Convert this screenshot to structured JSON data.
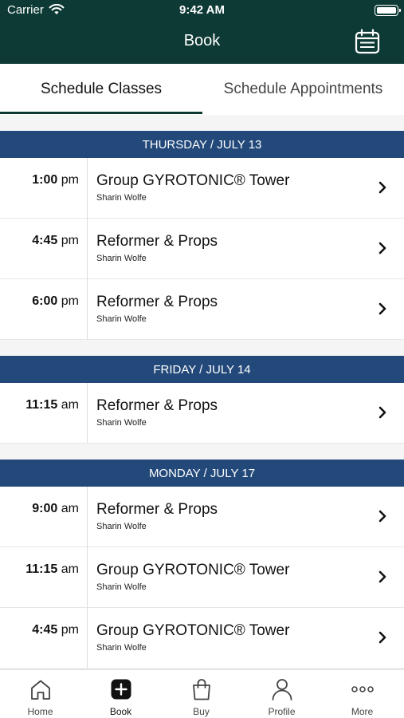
{
  "status": {
    "carrier": "Carrier",
    "time": "9:42 AM"
  },
  "nav": {
    "title": "Book",
    "calendar_icon": "calendar-icon"
  },
  "tabs": [
    {
      "label": "Schedule Classes",
      "active": true
    },
    {
      "label": "Schedule Appointments",
      "active": false
    }
  ],
  "days": [
    {
      "header": "THURSDAY / JULY 13",
      "classes": [
        {
          "time": "1:00",
          "ampm": "pm",
          "name": "Group GYROTONIC® Tower",
          "instructor": "Sharin Wolfe"
        },
        {
          "time": "4:45",
          "ampm": "pm",
          "name": "Reformer & Props",
          "instructor": "Sharin Wolfe"
        },
        {
          "time": "6:00",
          "ampm": "pm",
          "name": "Reformer & Props",
          "instructor": "Sharin Wolfe"
        }
      ]
    },
    {
      "header": "FRIDAY / JULY 14",
      "classes": [
        {
          "time": "11:15",
          "ampm": "am",
          "name": "Reformer & Props",
          "instructor": "Sharin Wolfe"
        }
      ]
    },
    {
      "header": "MONDAY / JULY 17",
      "classes": [
        {
          "time": "9:00",
          "ampm": "am",
          "name": "Reformer & Props",
          "instructor": "Sharin Wolfe"
        },
        {
          "time": "11:15",
          "ampm": "am",
          "name": "Group GYROTONIC® Tower",
          "instructor": "Sharin Wolfe"
        },
        {
          "time": "4:45",
          "ampm": "pm",
          "name": "Group GYROTONIC® Tower",
          "instructor": "Sharin Wolfe"
        }
      ]
    }
  ],
  "tabbar": [
    {
      "label": "Home",
      "icon": "home-icon",
      "active": false
    },
    {
      "label": "Book",
      "icon": "plus-square-icon",
      "active": true
    },
    {
      "label": "Buy",
      "icon": "shopping-bag-icon",
      "active": false
    },
    {
      "label": "Profile",
      "icon": "person-icon",
      "active": false
    },
    {
      "label": "More",
      "icon": "more-dots-icon",
      "active": false
    }
  ],
  "colors": {
    "nav_bg": "#0d3a35",
    "day_header_bg": "#23497a",
    "background": "#f5f5f5"
  }
}
